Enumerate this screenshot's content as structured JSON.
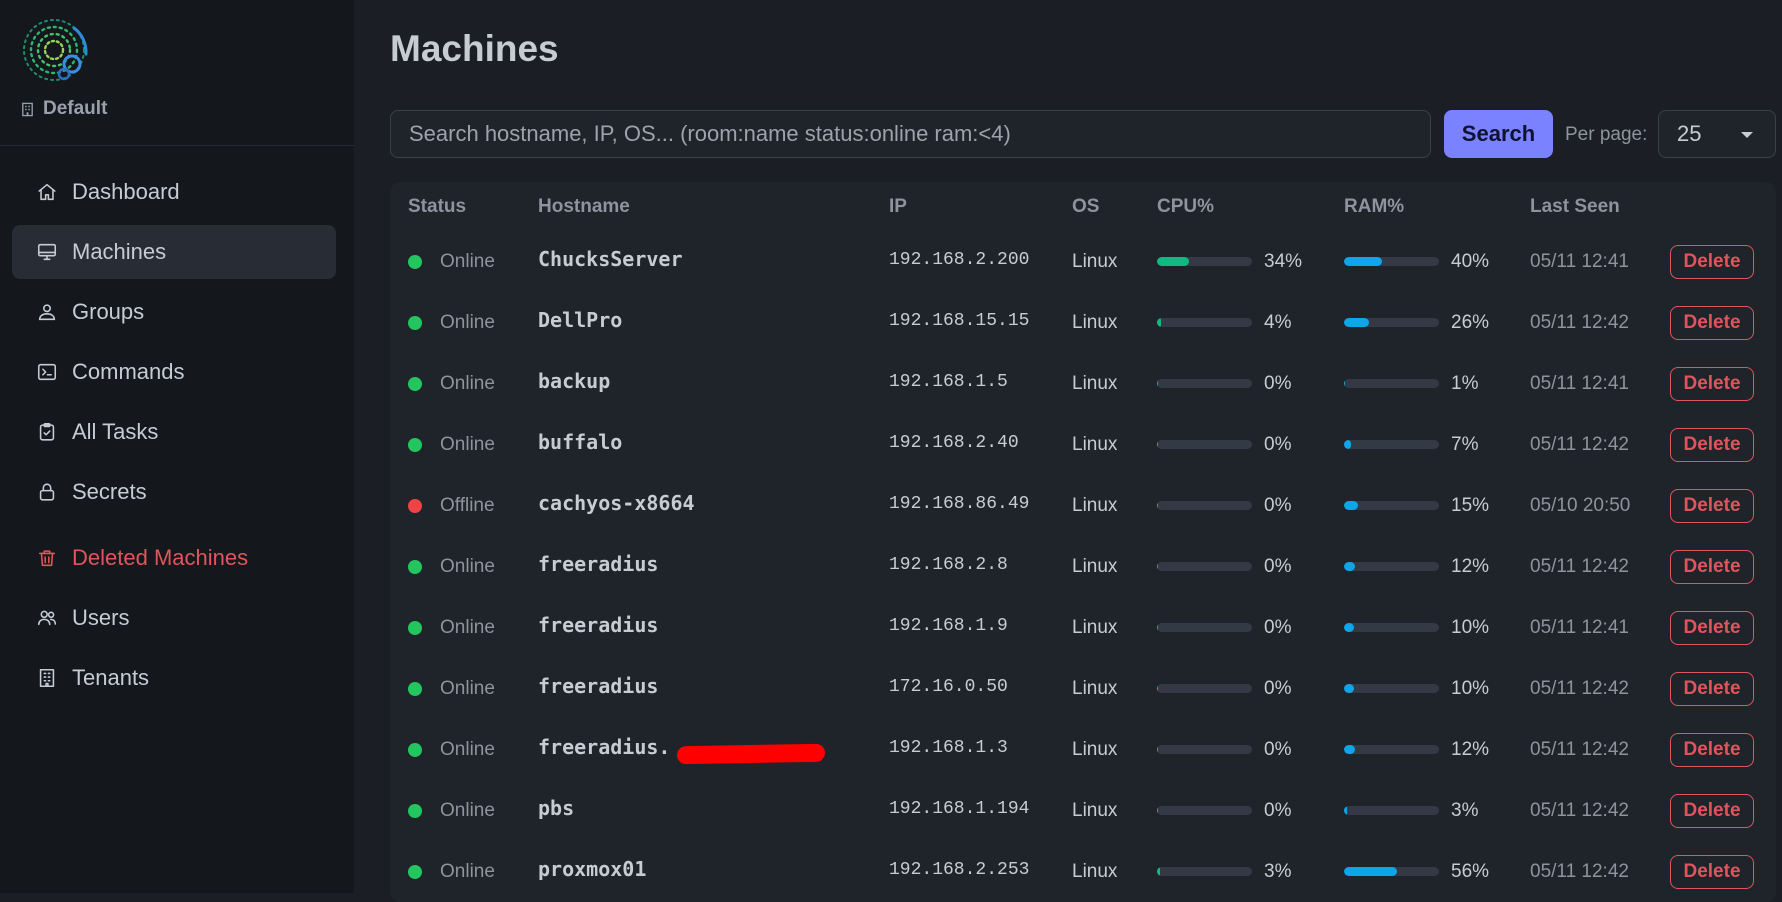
{
  "sidebar": {
    "tenant": "Default",
    "items": [
      {
        "label": "Dashboard",
        "icon": "home-icon",
        "name": "sidebar-item-dashboard",
        "active": false,
        "danger": false
      },
      {
        "label": "Machines",
        "icon": "monitor-icon",
        "name": "sidebar-item-machines",
        "active": true,
        "danger": false
      },
      {
        "label": "Groups",
        "icon": "group-icon",
        "name": "sidebar-item-groups",
        "active": false,
        "danger": false
      },
      {
        "label": "Commands",
        "icon": "terminal-icon",
        "name": "sidebar-item-commands",
        "active": false,
        "danger": false
      },
      {
        "label": "All Tasks",
        "icon": "clipboard-check-icon",
        "name": "sidebar-item-all-tasks",
        "active": false,
        "danger": false
      },
      {
        "label": "Secrets",
        "icon": "lock-icon",
        "name": "sidebar-item-secrets",
        "active": false,
        "danger": false
      },
      {
        "label": "Deleted Machines",
        "icon": "trash-icon",
        "name": "sidebar-item-deleted-machines",
        "active": false,
        "danger": true
      },
      {
        "label": "Users",
        "icon": "users-icon",
        "name": "sidebar-item-users",
        "active": false,
        "danger": false
      },
      {
        "label": "Tenants",
        "icon": "building-icon",
        "name": "sidebar-item-tenants",
        "active": false,
        "danger": false
      }
    ]
  },
  "main": {
    "title": "Machines",
    "search": {
      "placeholder": "Search hostname, IP, OS... (room:name status:online ram:<4)",
      "value": "",
      "button_label": "Search"
    },
    "per_page": {
      "label": "Per page:",
      "value": "25"
    }
  },
  "colors": {
    "online": "#22c55e",
    "offline": "#ef4444",
    "cpu_bar": "#10b981",
    "ram_bar": "#0ea5e9",
    "accent": "#7b82ff",
    "danger": "#e0555b"
  },
  "table": {
    "columns": [
      "Status",
      "Hostname",
      "IP",
      "OS",
      "CPU%",
      "RAM%",
      "Last Seen"
    ],
    "delete_label": "Delete",
    "rows": [
      {
        "status": "Online",
        "hostname": "ChucksServer",
        "ip": "192.168.2.200",
        "os": "Linux",
        "cpu": 34,
        "cpu_text": "34%",
        "ram": 40,
        "ram_text": "40%",
        "last_seen": "05/11 12:41",
        "redacted": false
      },
      {
        "status": "Online",
        "hostname": "DellPro",
        "ip": "192.168.15.15",
        "os": "Linux",
        "cpu": 4,
        "cpu_text": "4%",
        "ram": 26,
        "ram_text": "26%",
        "last_seen": "05/11 12:42",
        "redacted": false
      },
      {
        "status": "Online",
        "hostname": "backup",
        "ip": "192.168.1.5",
        "os": "Linux",
        "cpu": 0,
        "cpu_text": "0%",
        "ram": 1,
        "ram_text": "1%",
        "last_seen": "05/11 12:41",
        "redacted": false
      },
      {
        "status": "Online",
        "hostname": "buffalo",
        "ip": "192.168.2.40",
        "os": "Linux",
        "cpu": 0,
        "cpu_text": "0%",
        "ram": 7,
        "ram_text": "7%",
        "last_seen": "05/11 12:42",
        "redacted": false
      },
      {
        "status": "Offline",
        "hostname": "cachyos-x8664",
        "ip": "192.168.86.49",
        "os": "Linux",
        "cpu": 0,
        "cpu_text": "0%",
        "ram": 15,
        "ram_text": "15%",
        "last_seen": "05/10 20:50",
        "redacted": false
      },
      {
        "status": "Online",
        "hostname": "freeradius",
        "ip": "192.168.2.8",
        "os": "Linux",
        "cpu": 0,
        "cpu_text": "0%",
        "ram": 12,
        "ram_text": "12%",
        "last_seen": "05/11 12:42",
        "redacted": false
      },
      {
        "status": "Online",
        "hostname": "freeradius",
        "ip": "192.168.1.9",
        "os": "Linux",
        "cpu": 0,
        "cpu_text": "0%",
        "ram": 10,
        "ram_text": "10%",
        "last_seen": "05/11 12:41",
        "redacted": false
      },
      {
        "status": "Online",
        "hostname": "freeradius",
        "ip": "172.16.0.50",
        "os": "Linux",
        "cpu": 0,
        "cpu_text": "0%",
        "ram": 10,
        "ram_text": "10%",
        "last_seen": "05/11 12:42",
        "redacted": false
      },
      {
        "status": "Online",
        "hostname": "freeradius.",
        "ip": "192.168.1.3",
        "os": "Linux",
        "cpu": 0,
        "cpu_text": "0%",
        "ram": 12,
        "ram_text": "12%",
        "last_seen": "05/11 12:42",
        "redacted": true
      },
      {
        "status": "Online",
        "hostname": "pbs",
        "ip": "192.168.1.194",
        "os": "Linux",
        "cpu": 0,
        "cpu_text": "0%",
        "ram": 3,
        "ram_text": "3%",
        "last_seen": "05/11 12:42",
        "redacted": false
      },
      {
        "status": "Online",
        "hostname": "proxmox01",
        "ip": "192.168.2.253",
        "os": "Linux",
        "cpu": 3,
        "cpu_text": "3%",
        "ram": 56,
        "ram_text": "56%",
        "last_seen": "05/11 12:42",
        "redacted": false
      }
    ]
  }
}
